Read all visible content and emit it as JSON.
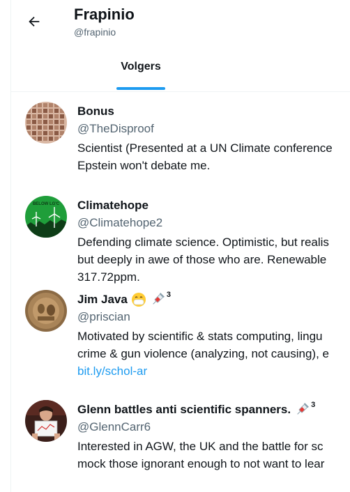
{
  "header": {
    "title": "Frapinio",
    "handle": "@frapinio"
  },
  "tabs": [
    {
      "label": "Volgers"
    }
  ],
  "colors": {
    "accent": "#1d9bf0",
    "text": "#0f1419",
    "secondary": "#536471"
  },
  "followers": [
    {
      "name": "Bonus",
      "handle": "@TheDisproof",
      "avatar_icon": "face-grid-avatar",
      "bio_lines": [
        "Scientist (Presented at a UN Climate conference",
        "Epstein won't debate me."
      ]
    },
    {
      "name": "Climatehope",
      "handle": "@Climatehope2",
      "avatar_icon": "wind-turbine-avatar",
      "avatar_text": "BELOW LG'C",
      "bio_lines": [
        "Defending climate science. Optimistic, but realis",
        "but deeply in awe of those who are. Renewable",
        "317.72ppm."
      ]
    },
    {
      "name": "Jim Java",
      "handle": "@priscian",
      "avatar_icon": "bronze-relief-avatar",
      "name_emojis": [
        "mask-face-emoji",
        "syringe-emoji"
      ],
      "name_sup": "3",
      "bio_lines": [
        "Motivated by scientific & stats computing, lingu",
        "crime & gun violence (analyzing, not causing), e"
      ],
      "bio_link": "bit.ly/schol-ar"
    },
    {
      "name": "Glenn battles anti scientific spanners.",
      "handle": "@GlennCarr6",
      "avatar_icon": "person-holding-sign-avatar",
      "name_emojis": [
        "syringe-emoji"
      ],
      "name_sup": "3",
      "bio_lines": [
        "Interested in AGW, the UK and the battle for sc",
        "mock those ignorant enough to not want to lear"
      ]
    }
  ]
}
